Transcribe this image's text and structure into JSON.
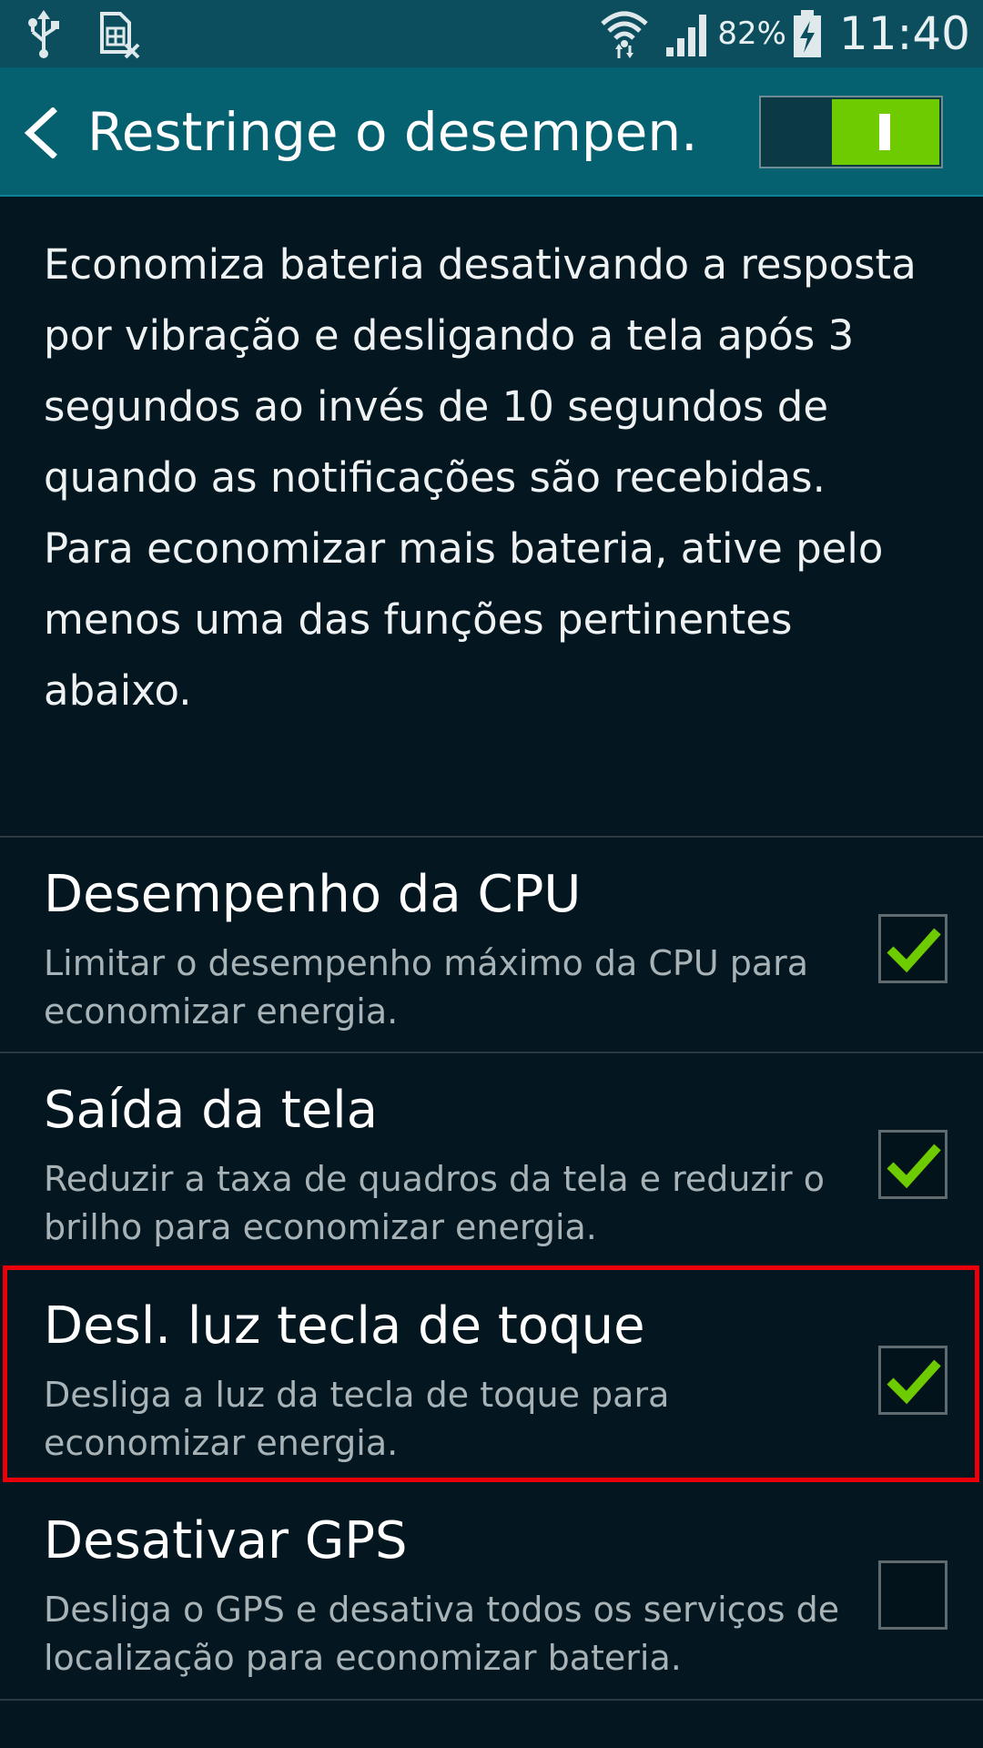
{
  "status_bar": {
    "icons_left": [
      "usb-icon",
      "sim-card-blocked-icon"
    ],
    "icons_right": [
      "wifi-icon",
      "signal-icon",
      "battery-charging-icon"
    ],
    "battery_percent": "82%",
    "time": "11:40"
  },
  "header": {
    "title": "Restringe o desempen.",
    "back_icon": "chevron-left-icon",
    "master_switch": {
      "on": true
    }
  },
  "description": {
    "paragraph1": "Economiza bateria desativando a resposta por vibração e desligando a tela após 3 segundos ao invés de 10 segundos de quando as notificações são recebidas.",
    "paragraph2": "Para economizar mais bateria, ative pelo menos uma das funções pertinentes abaixo."
  },
  "options": [
    {
      "title": "Desempenho da CPU",
      "summary": "Limitar o desempenho máximo da CPU para economizar energia.",
      "checked": true
    },
    {
      "title": "Saída da tela",
      "summary": "Reduzir a taxa de quadros da tela e reduzir o brilho para economizar energia.",
      "checked": true
    },
    {
      "title": "Desl. luz tecla de toque",
      "summary": "Desliga a luz da tecla de toque para economizar energia.",
      "checked": true
    },
    {
      "title": "Desativar GPS",
      "summary": "Desliga o GPS e desativa todos os serviços de localização para economizar bateria.",
      "checked": false
    }
  ],
  "colors": {
    "status_bar": "#0d4e5e",
    "action_bar": "#05606f",
    "background": "#04161f",
    "accent_green": "#6ecb00",
    "highlight_red": "#e8000b"
  }
}
